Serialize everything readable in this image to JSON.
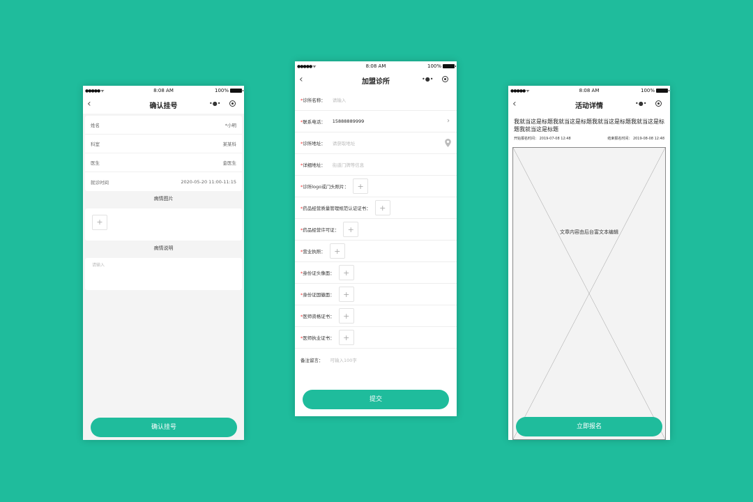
{
  "status_bar": {
    "signal": "●●●●● ᯤ",
    "time": "8:08 AM",
    "battery": "100%"
  },
  "screen1": {
    "nav_back": "‹",
    "title": "确认挂号",
    "info_rows": [
      {
        "label": "姓名",
        "value": "*小明"
      },
      {
        "label": "科室",
        "value": "某某科"
      },
      {
        "label": "医生",
        "value": "金医生"
      },
      {
        "label": "就诊时间",
        "value": "2020-05-20 11:00-11:15"
      }
    ],
    "image_section_title": "病情图片",
    "desc_section_title": "病情说明",
    "desc_placeholder": "请输入",
    "submit_label": "确认挂号"
  },
  "screen2": {
    "nav_back": "‹",
    "title": "加盟诊所",
    "fields": [
      {
        "label": "诊所名称：",
        "placeholder": "请输入"
      },
      {
        "label": "联系电话：",
        "value": "15888889999"
      },
      {
        "label": "诊所地址：",
        "placeholder": "请获取地址"
      },
      {
        "label": "详细地址：",
        "placeholder": "街道门牌等信息"
      },
      {
        "label": "诊所logo或门头照片："
      },
      {
        "label": "药品经营质量管理规范认证证书："
      },
      {
        "label": "药品经营许可证："
      },
      {
        "label": "营业执照："
      },
      {
        "label": "身份证头像面："
      },
      {
        "label": "身份证国徽面："
      },
      {
        "label": "医师资格证书："
      },
      {
        "label": "医师执业证书："
      }
    ],
    "remark_label": "备注留言：",
    "remark_placeholder": "可输入100字",
    "submit_label": "提交"
  },
  "screen3": {
    "nav_back": "‹",
    "title": "活动详情",
    "article_title": "我就当这是标题我就当这是标题我就当这是标题我就当这是标题我就当这是标题",
    "start_label": "开始报名时间：",
    "start_date": "2019-07-08 12:48",
    "end_label": "结束报名时间：",
    "end_date": "2019-08-08 12:48",
    "content_placeholder": "文章内容由后台富文本编辑",
    "submit_label": "立即报名"
  },
  "icons": {
    "plus": "+",
    "chevron_right": "›",
    "capsule_dots": "•●•"
  },
  "colors": {
    "accent": "#1fbc9c",
    "required": "#e33333"
  }
}
